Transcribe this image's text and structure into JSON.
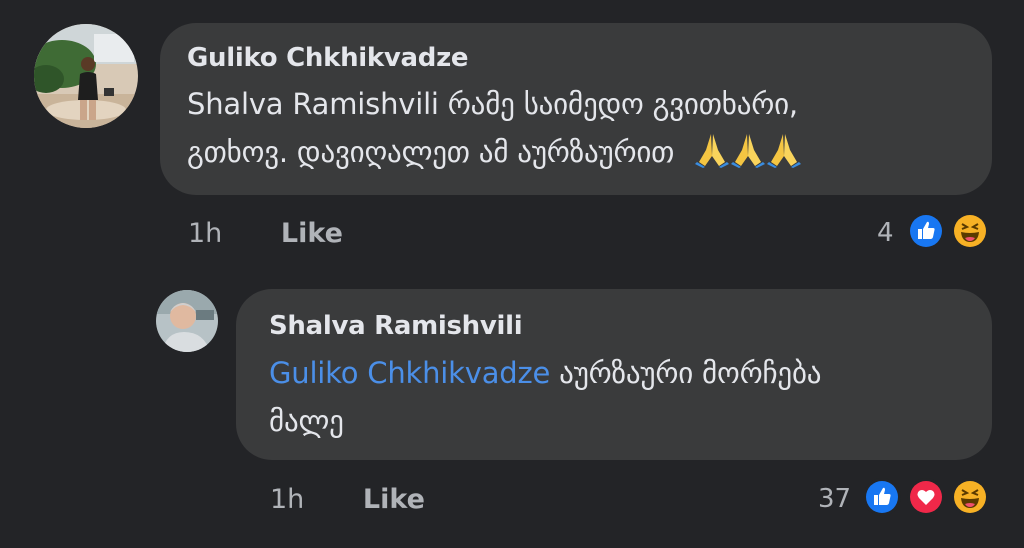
{
  "comments": [
    {
      "author": "Guliko Chkhikvadze",
      "text_line1": "Shalva Ramishvili რამე საიმედო გვითხარი,",
      "text_line2": "გთხოვ. დავიღალეთ ამ აურზაურით",
      "emoji_icons": [
        "folded-hands-icon",
        "folded-hands-icon",
        "folded-hands-icon"
      ],
      "time": "1h",
      "like_label": "Like",
      "reaction_count": "4",
      "reactions": [
        "like",
        "haha"
      ]
    },
    {
      "author": "Shalva Ramishvili",
      "mention": "Guliko Chkhikvadze",
      "text_line1": " აურზაური მორჩება",
      "text_line2": "მალე",
      "time": "1h",
      "like_label": "Like",
      "reaction_count": "37",
      "reactions": [
        "like",
        "love",
        "haha"
      ]
    }
  ],
  "colors": {
    "background": "#232427",
    "bubble": "#3a3b3c",
    "mention": "#4b8fe8",
    "meta_text": "#b0b3b8",
    "like_reaction": "#1877f2",
    "love_reaction": "#f02849",
    "haha_reaction": "#f7b125"
  }
}
